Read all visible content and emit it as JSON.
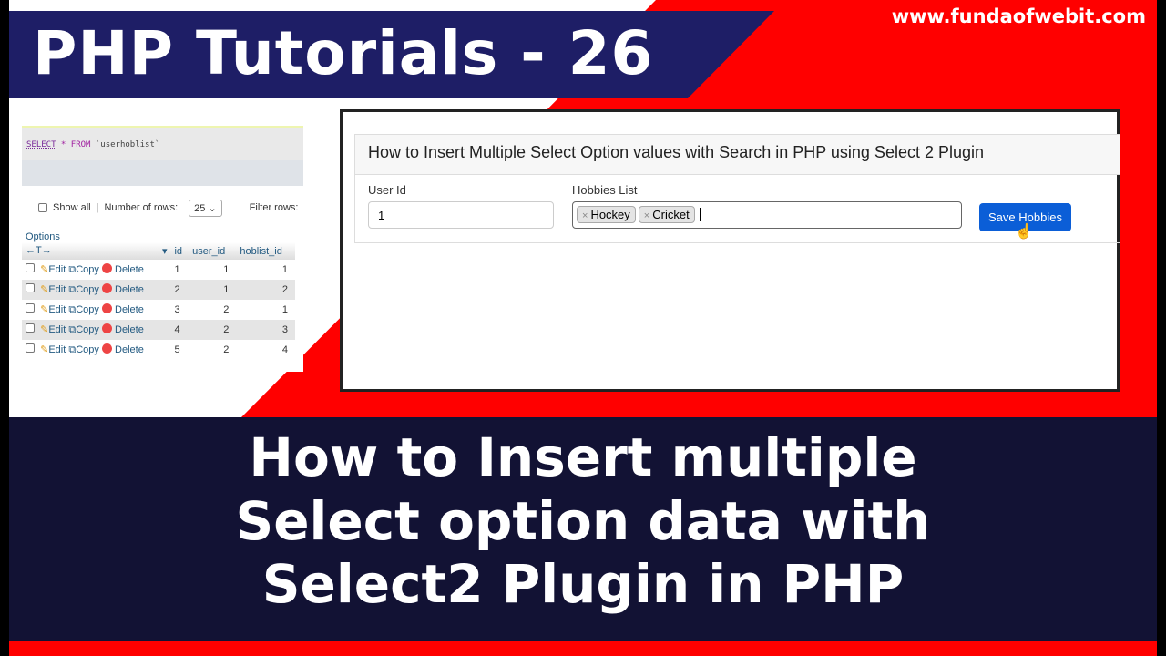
{
  "colors": {
    "red": "#ff0000",
    "navy_banner": "#1e1e66",
    "bottom_band": "#121234",
    "accent_button": "#0b5ed7"
  },
  "banner": {
    "series_title": "PHP Tutorials - 26",
    "site": "www.fundaofwebit.com"
  },
  "phpmyadmin": {
    "sql": {
      "keyword": "SELECT",
      "rest": " * FROM ",
      "table": "`userhoblist`"
    },
    "show_all": "Show all",
    "rows_label": "Number of rows:",
    "rows_value": "25",
    "filter_label": "Filter rows:",
    "options_label": "Options",
    "arrows": "←T→",
    "columns": [
      "id",
      "user_id",
      "hoblist_id"
    ],
    "actions": {
      "edit": "Edit",
      "copy": "Copy",
      "delete": "Delete"
    },
    "rows": [
      [
        "1",
        "1",
        "1"
      ],
      [
        "2",
        "1",
        "2"
      ],
      [
        "3",
        "2",
        "1"
      ],
      [
        "4",
        "2",
        "3"
      ],
      [
        "5",
        "2",
        "4"
      ]
    ]
  },
  "form": {
    "title": "How to Insert Multiple Select Option values with Search in PHP using Select 2 Plugin",
    "user_id_label": "User Id",
    "user_id_value": "1",
    "hobbies_label": "Hobbies List",
    "hobbies": [
      "Hockey",
      "Cricket"
    ],
    "remove_symbol": "×",
    "save_button": "Save Hobbies"
  },
  "headline": [
    "How to Insert multiple",
    "Select option data with",
    "Select2 Plugin in PHP"
  ]
}
